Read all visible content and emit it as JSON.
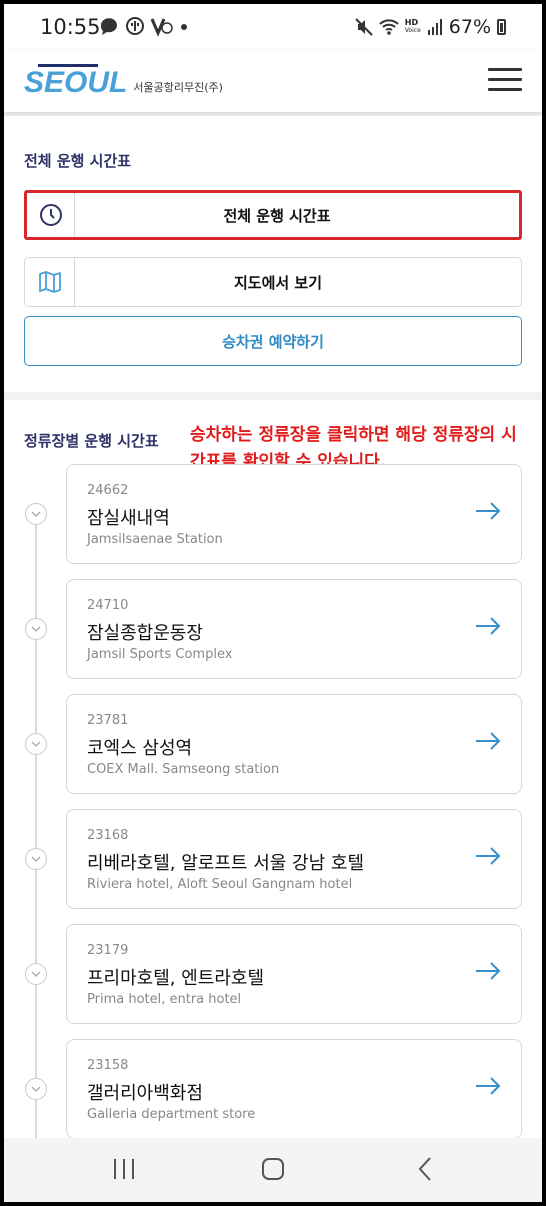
{
  "status_bar": {
    "time": "10:55",
    "battery": "67%",
    "hd_label": "HD",
    "voice_label": "Voice"
  },
  "header": {
    "logo_text": "SEOUL",
    "logo_subtitle": "서울공항리무진(주)"
  },
  "schedule_section": {
    "title": "전체 운행 시간표",
    "full_schedule_label": "전체 운행 시간표",
    "map_label": "지도에서 보기",
    "reserve_label": "승차권 예약하기"
  },
  "stops_section": {
    "title": "정류장별 운행 시간표",
    "annotation": "승차하는 정류장을 클릭하면 해당 정류장의 시간표를 확인할 수 있습니다.",
    "stops": [
      {
        "code": "24662",
        "name": "잠실새내역",
        "en": "Jamsilsaenae Station"
      },
      {
        "code": "24710",
        "name": "잠실종합운동장",
        "en": "Jamsil Sports Complex"
      },
      {
        "code": "23781",
        "name": "코엑스 삼성역",
        "en": "COEX Mall. Samseong station"
      },
      {
        "code": "23168",
        "name": "리베라호텔, 알로프트 서울 강남 호텔",
        "en": "Riviera hotel, Aloft Seoul Gangnam hotel"
      },
      {
        "code": "23179",
        "name": "프리마호텔, 엔트라호텔",
        "en": "Prima hotel, entra hotel"
      },
      {
        "code": "23158",
        "name": "갤러리아백화점",
        "en": "Galleria department store"
      }
    ]
  },
  "colors": {
    "brand_navy": "#2e3368",
    "brand_blue": "#4aa0d8",
    "highlight_red": "#d8262a",
    "annotation_red": "#e21b1b",
    "arrow_blue": "#3a8fc7"
  },
  "icons": {
    "clock": "clock-icon",
    "map": "map-icon",
    "arrow": "arrow-right-icon",
    "chevron": "chevron-down-icon",
    "menu": "menu-icon"
  }
}
